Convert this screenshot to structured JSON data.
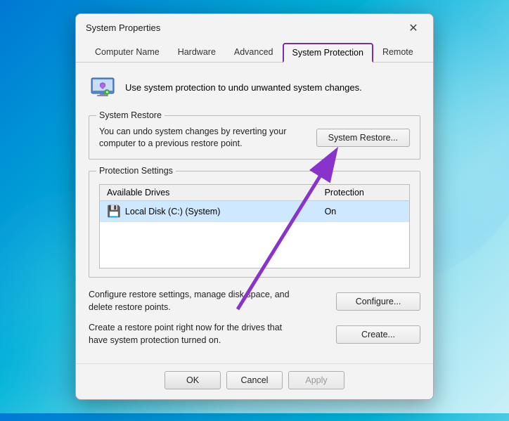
{
  "dialog": {
    "title": "System Properties",
    "close_label": "✕"
  },
  "tabs": [
    {
      "id": "computer-name",
      "label": "Computer Name",
      "active": false
    },
    {
      "id": "hardware",
      "label": "Hardware",
      "active": false
    },
    {
      "id": "advanced",
      "label": "Advanced",
      "active": false
    },
    {
      "id": "system-protection",
      "label": "System Protection",
      "active": true
    },
    {
      "id": "remote",
      "label": "Remote",
      "active": false
    }
  ],
  "top_description": "Use system protection to undo unwanted system changes.",
  "system_restore_section": {
    "label": "System Restore",
    "description": "You can undo system changes by reverting your computer to a previous restore point.",
    "button_label": "System Restore..."
  },
  "protection_settings_section": {
    "label": "Protection Settings",
    "table_headers": [
      "Available Drives",
      "Protection"
    ],
    "drives": [
      {
        "name": "Local Disk (C:) (System)",
        "protection": "On"
      }
    ]
  },
  "configure_row": {
    "description": "Configure restore settings, manage disk space, and delete restore points.",
    "button_label": "Configure..."
  },
  "create_row": {
    "description": "Create a restore point right now for the drives that have system protection turned on.",
    "button_label": "Create..."
  },
  "footer_buttons": {
    "ok": "OK",
    "cancel": "Cancel",
    "apply": "Apply"
  }
}
